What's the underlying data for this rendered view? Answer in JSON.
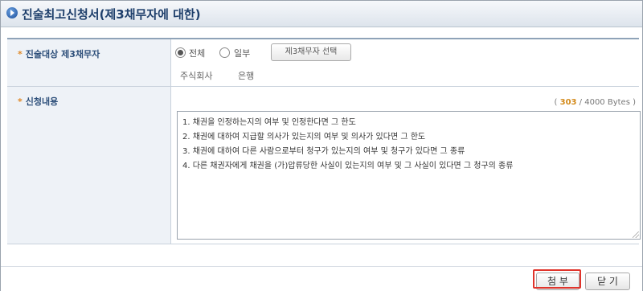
{
  "window": {
    "title": "진술최고신청서(제3채무자에 대한)"
  },
  "form": {
    "row1": {
      "label": "진술대상 제3채무자",
      "radio_all": "전체",
      "radio_partial": "일부",
      "select_button": "제3채무자 선택",
      "sub_left": "주식회사",
      "sub_right": "은행"
    },
    "row2": {
      "label": "신청내용",
      "bytes_used": "303",
      "bytes_rest": "/ 4000 Bytes )",
      "bytes_open": "(",
      "lines": [
        "1. 채권을 인정하는지의 여부 및 인정한다면 그 한도",
        "2. 채권에 대하여 지급할 의사가 있는지의 여부 및 의사가 있다면 그 한도",
        "3. 채권에 대하여 다른 사람으로부터 청구가 있는지의 여부 및 청구가 있다면 그 종류",
        "4. 다른 채권자에게 채권을 (가)압류당한 사실이 있는지의 여부 및 그 사실이 있다면 그 청구의 종류"
      ]
    }
  },
  "buttons": {
    "attach": "첨 부",
    "close": "닫 기"
  },
  "colors": {
    "highlight": "#e0342b",
    "bytes_accent": "#d38a1a",
    "label": "#2d4f7a"
  }
}
